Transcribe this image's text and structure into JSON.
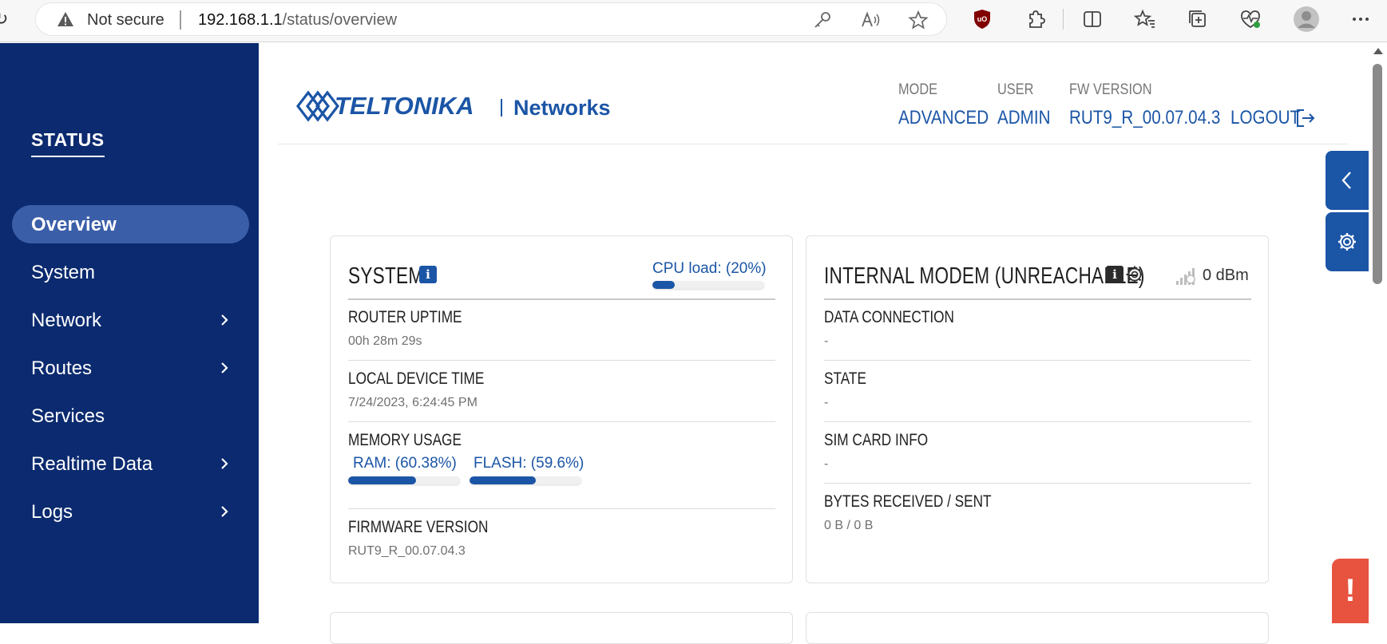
{
  "browser": {
    "security_label": "Not secure",
    "url_host": "192.168.1.1",
    "url_path": "/status/overview"
  },
  "sidebar": {
    "section_title": "STATUS",
    "items": [
      {
        "label": "Overview",
        "active": true,
        "has_children": false
      },
      {
        "label": "System",
        "active": false,
        "has_children": false
      },
      {
        "label": "Network",
        "active": false,
        "has_children": true
      },
      {
        "label": "Routes",
        "active": false,
        "has_children": true
      },
      {
        "label": "Services",
        "active": false,
        "has_children": false
      },
      {
        "label": "Realtime Data",
        "active": false,
        "has_children": true
      },
      {
        "label": "Logs",
        "active": false,
        "has_children": true
      }
    ]
  },
  "header": {
    "brand": "TELTONIKA",
    "brand_suffix": "Networks",
    "mode_label": "MODE",
    "mode_value": "ADVANCED",
    "user_label": "USER",
    "user_value": "ADMIN",
    "fw_label": "FW VERSION",
    "fw_value": "RUT9_R_00.07.04.3",
    "logout_label": "LOGOUT"
  },
  "system_card": {
    "title": "SYSTEM",
    "cpu_label": "CPU load: (20%)",
    "cpu_percent": 20,
    "rows": [
      {
        "key": "ROUTER UPTIME",
        "value": "00h 28m 29s"
      },
      {
        "key": "LOCAL DEVICE TIME",
        "value": "7/24/2023, 6:24:45 PM"
      },
      {
        "key": "MEMORY USAGE",
        "value": ""
      },
      {
        "key": "FIRMWARE VERSION",
        "value": "RUT9_R_00.07.04.3"
      }
    ],
    "ram_label": "RAM: (60.38%)",
    "ram_percent": 60.38,
    "flash_label": "FLASH: (59.6%)",
    "flash_percent": 59.6
  },
  "modem_card": {
    "title": "INTERNAL MODEM (UNREACHABLE)",
    "signal": "0 dBm",
    "rows": [
      {
        "key": "DATA CONNECTION",
        "value": "-"
      },
      {
        "key": "STATE",
        "value": "-"
      },
      {
        "key": "SIM CARD INFO",
        "value": "-"
      },
      {
        "key": "BYTES RECEIVED / SENT",
        "value": "0 B / 0 B"
      }
    ]
  },
  "alert_tab": "!",
  "colors": {
    "sidebar_bg": "#0b2a6f",
    "sidebar_active": "#3b5ea9",
    "accent": "#1b55a6",
    "alert": "#e7533f"
  }
}
